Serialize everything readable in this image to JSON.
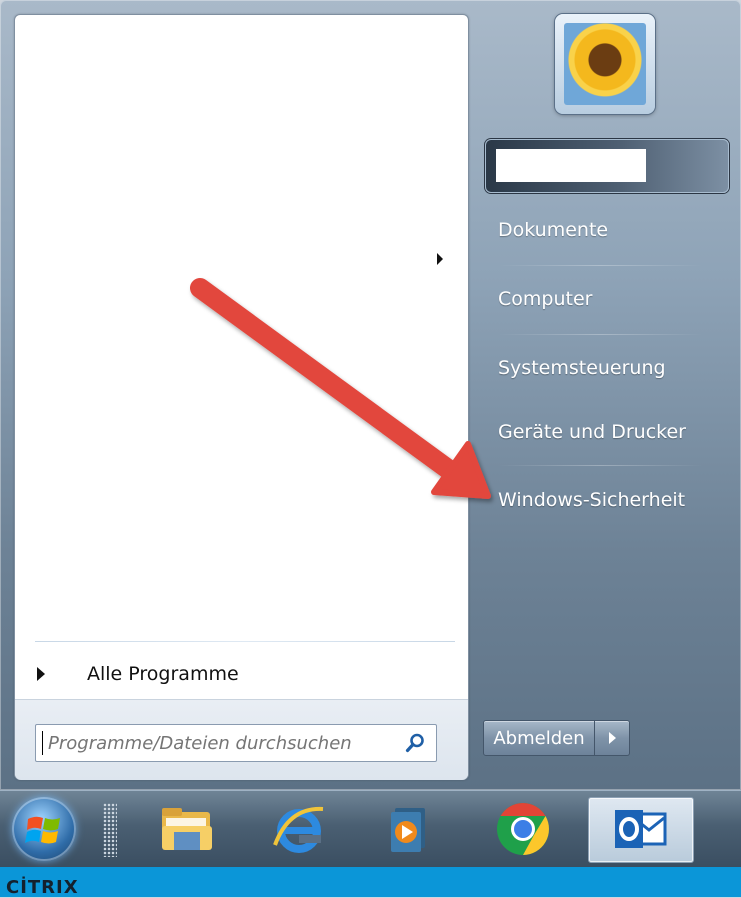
{
  "right_panel": {
    "links": [
      "Dokumente",
      "Computer",
      "Systemsteuerung",
      "Geräte und Drucker",
      "Windows-Sicherheit"
    ],
    "shutdown_label": "Abmelden"
  },
  "left_panel": {
    "all_programs_label": "Alle Programme",
    "search_placeholder": "Programme/Dateien durchsuchen"
  },
  "taskbar": {
    "pinned": [
      "file-explorer-icon",
      "internet-explorer-icon",
      "media-player-icon",
      "chrome-icon",
      "outlook-icon"
    ]
  },
  "citrix_label": "CİTRIX",
  "colors": {
    "annotation_arrow": "#e2463d",
    "citrix_bar": "#0b96d8"
  }
}
